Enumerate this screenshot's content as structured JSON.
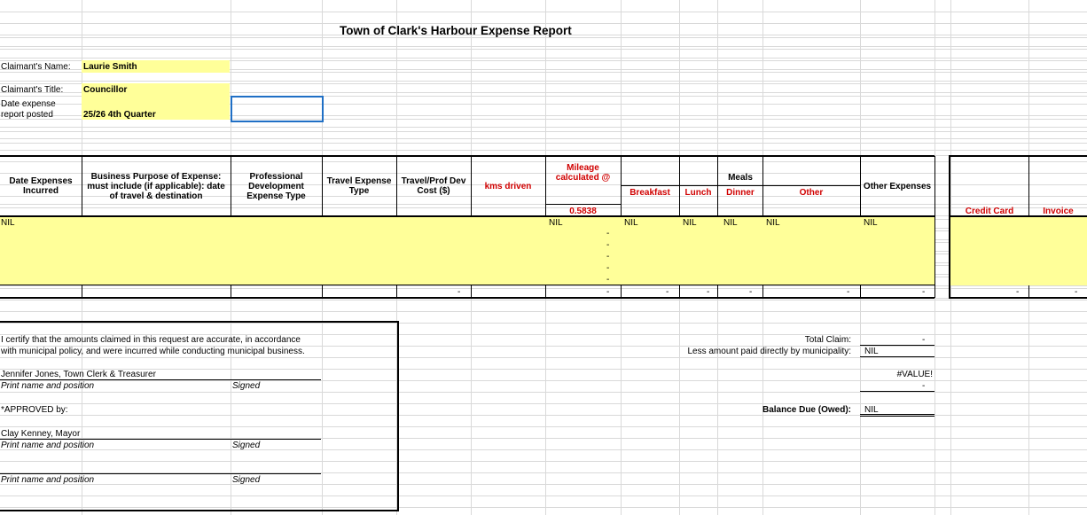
{
  "title": "Town of Clark's Harbour Expense Report",
  "claimant": {
    "name_label": "Claimant's Name:",
    "name_value": "Laurie Smith",
    "title_label": "Claimant's Title:",
    "title_value": "Councillor",
    "posted_label_1": "Date expense",
    "posted_label_2": "report posted",
    "posted_value": "25/26 4th Quarter"
  },
  "table": {
    "headers": {
      "date": "Date Expenses Incurred",
      "purpose": "Business Purpose of Expense: must include (if applicable): date of travel & destination",
      "prof_dev": "Professional Development Expense Type",
      "travel_type": "Travel Expense Type",
      "travel_cost": "Travel/Prof Dev Cost ($)",
      "kms": "kms driven",
      "mileage": "Mileage calculated @",
      "mileage_rate": "0.5838",
      "meals": "Meals",
      "breakfast": "Breakfast",
      "lunch": "Lunch",
      "dinner": "Dinner",
      "other": "Other",
      "other_expenses": "Other Expenses",
      "credit_card": "Credit Card",
      "invoice": "Invoice"
    },
    "nil": "NIL",
    "dash": "-"
  },
  "certify": {
    "line1": "I certify that the amounts claimed in this request are accurate, in accordance",
    "line2": "with municipal policy, and were incurred while conducting municipal business.",
    "person1": "Jennifer Jones, Town Clerk & Treasurer",
    "print_label": "Print name and position",
    "signed_label": "Signed",
    "approved": "*APPROVED by:",
    "person2": "Clay Kenney, Mayor"
  },
  "totals": {
    "total_claim_label": "Total Claim:",
    "total_claim_value": "-",
    "less_paid_label": "Less amount paid directly by municipality:",
    "less_paid_value": "NIL",
    "value_error": "#VALUE!",
    "dash": "-",
    "balance_label": "Balance Due (Owed):",
    "balance_value": "NIL"
  },
  "colors": {
    "highlight": "#ffff99",
    "header_red": "#d00000",
    "gridline": "#d9d9d9",
    "selection": "#1f6fc5"
  }
}
